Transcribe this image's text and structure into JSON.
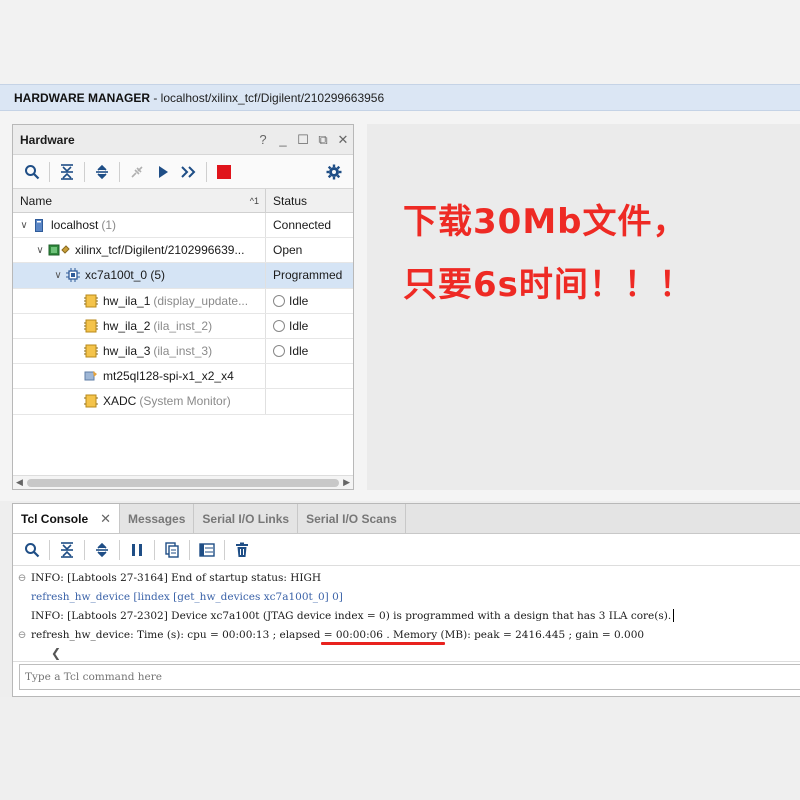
{
  "window": {
    "title_bold": "HARDWARE MANAGER",
    "title_path": " - localhost/xilinx_tcf/Digilent/210299663956"
  },
  "hardware": {
    "panel_title": "Hardware",
    "header_controls": [
      "?",
      "_",
      "☐",
      "⧉",
      "✕"
    ],
    "columns": {
      "name": "Name",
      "sort": "^1",
      "status": "Status"
    },
    "rows": [
      {
        "name": "localhost",
        "suffix": "(1)",
        "status": "Connected",
        "icon": "server-icon"
      },
      {
        "name": "xilinx_tcf/Digilent/2102996639...",
        "suffix": "",
        "status": "Open",
        "icon": "jtag-cable-icon"
      },
      {
        "name": "xc7a100t_0 (5)",
        "suffix": "",
        "status": "Programmed",
        "icon": "chip-icon"
      },
      {
        "name": "hw_ila_1",
        "suffix": "(display_update...",
        "status": "Idle",
        "icon": "ila-icon"
      },
      {
        "name": "hw_ila_2",
        "suffix": "(ila_inst_2)",
        "status": "Idle",
        "icon": "ila-icon"
      },
      {
        "name": "hw_ila_3",
        "suffix": "(ila_inst_3)",
        "status": "Idle",
        "icon": "ila-icon"
      },
      {
        "name": "mt25ql128-spi-x1_x2_x4",
        "suffix": "",
        "status": "",
        "icon": "flash-memory-icon"
      },
      {
        "name": "XADC",
        "suffix": "(System Monitor)",
        "status": "",
        "icon": "xadc-icon"
      }
    ]
  },
  "promo": {
    "line1": "下载30Mb文件，",
    "line2": "只要6s时间！！！"
  },
  "console": {
    "tabs": [
      "Tcl Console",
      "Messages",
      "Serial I/O Links",
      "Serial I/O Scans"
    ],
    "lines": [
      {
        "text": "INFO: [Labtools 27-3164] End of startup status: HIGH",
        "type": "info"
      },
      {
        "text": "refresh_hw_device [lindex [get_hw_devices xc7a100t_0] 0]",
        "type": "cmd"
      },
      {
        "text": "INFO: [Labtools 27-2302] Device xc7a100t (JTAG device index = 0) is programmed with a design that has 3 ILA core(s).",
        "type": "info"
      },
      {
        "text": "refresh_hw_device: Time (s): cpu = 00:00:13 ; elapsed = 00:00:06 . Memory (MB): peak = 2416.445 ; gain = 0.000",
        "type": "info"
      }
    ],
    "input_placeholder": "Type a Tcl command here"
  },
  "colors": {
    "accent_red": "#ee2a24",
    "selected_row": "#d5e4f5",
    "title_bar": "#dbe6f4"
  }
}
